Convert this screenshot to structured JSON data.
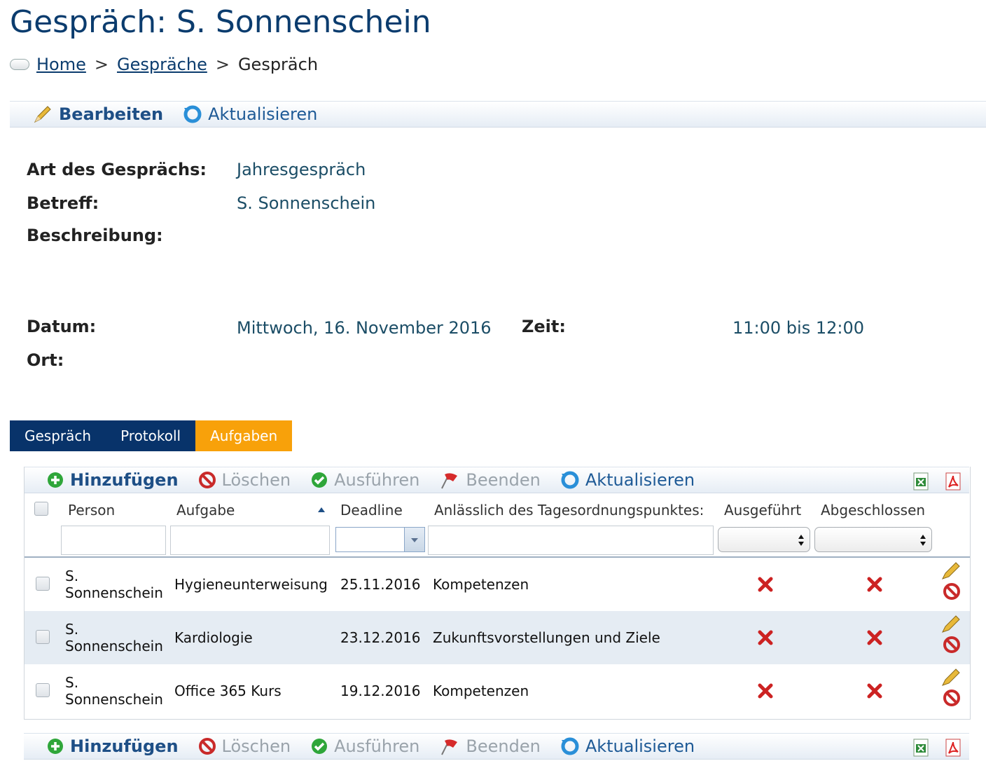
{
  "page_title": "Gespräch: S. Sonnenschein",
  "breadcrumb": {
    "home": "Home",
    "list": "Gespräche",
    "current": "Gespräch",
    "separator": ">"
  },
  "top_toolbar": {
    "edit": "Bearbeiten",
    "refresh": "Aktualisieren"
  },
  "details": {
    "art_label": "Art des Gesprächs:",
    "art_value": "Jahresgespräch",
    "betreff_label": "Betreff:",
    "betreff_value": "S. Sonnenschein",
    "beschreibung_label": "Beschreibung:",
    "datum_label": "Datum:",
    "datum_value": "Mittwoch, 16. November 2016",
    "zeit_label": "Zeit:",
    "zeit_value": "11:00 bis 12:00",
    "ort_label": "Ort:"
  },
  "tabs": [
    "Gespräch",
    "Protokoll",
    "Aufgaben"
  ],
  "grid_toolbar": {
    "add": "Hinzufügen",
    "delete": "Löschen",
    "execute": "Ausführen",
    "finish": "Beenden",
    "refresh": "Aktualisieren"
  },
  "columns": {
    "person": "Person",
    "aufgabe": "Aufgabe",
    "deadline": "Deadline",
    "tagesordnung": "Anlässlich des Tagesordnungspunktes:",
    "ausgefuehrt": "Ausgeführt",
    "abgeschlossen": "Abgeschlossen"
  },
  "rows": [
    {
      "person_line1": "S.",
      "person_line2": "Sonnenschein",
      "aufgabe": "Hygieneunterweisung",
      "deadline": "25.11.2016",
      "punkt": "Kompetenzen"
    },
    {
      "person_line1": "S.",
      "person_line2": "Sonnenschein",
      "aufgabe": "Kardiologie",
      "deadline": "23.12.2016",
      "punkt": "Zukunftsvorstellungen und Ziele"
    },
    {
      "person_line1": "S.",
      "person_line2": "Sonnenschein",
      "aufgabe": "Office 365 Kurs",
      "deadline": "19.12.2016",
      "punkt": "Kompetenzen"
    }
  ],
  "colors": {
    "brand_dark": "#08336a",
    "tab_active": "#f8a10a",
    "title": "#0b3c6e",
    "red_x": "#cc2222"
  }
}
